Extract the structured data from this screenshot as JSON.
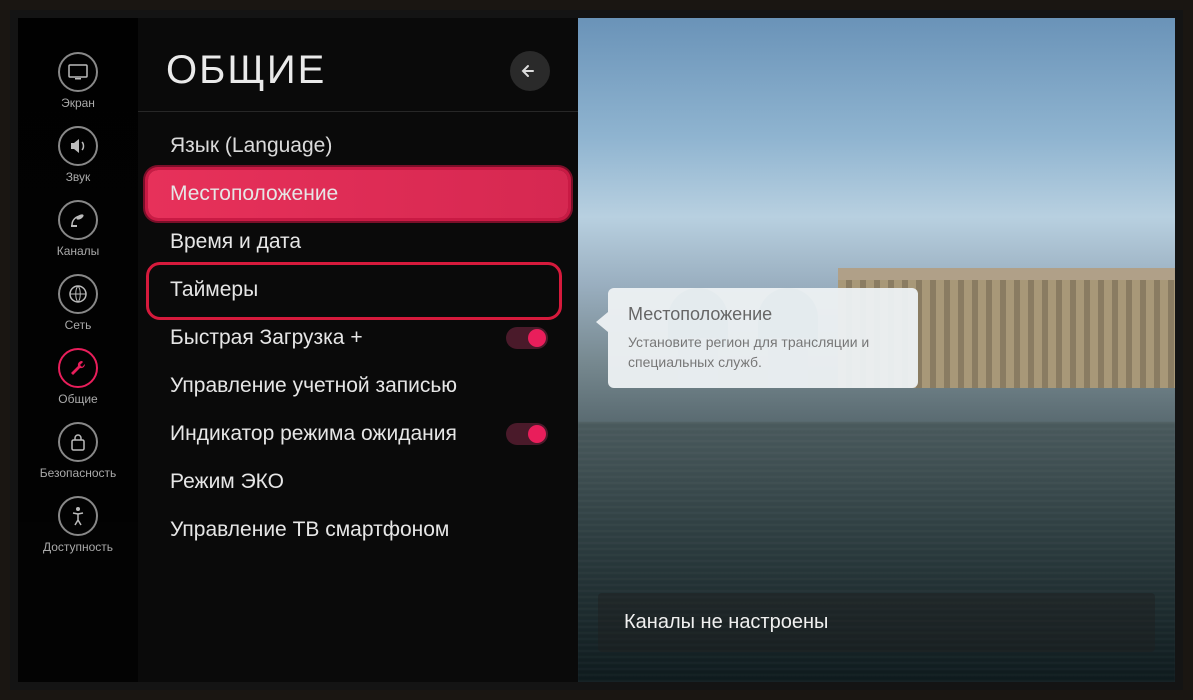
{
  "sidebar": {
    "items": [
      {
        "id": "screen",
        "label": "Экран",
        "icon": "tv-icon"
      },
      {
        "id": "sound",
        "label": "Звук",
        "icon": "speaker-icon"
      },
      {
        "id": "channels",
        "label": "Каналы",
        "icon": "satellite-icon"
      },
      {
        "id": "network",
        "label": "Сеть",
        "icon": "globe-icon"
      },
      {
        "id": "general",
        "label": "Общие",
        "icon": "wrench-icon",
        "active": true
      },
      {
        "id": "security",
        "label": "Безопасность",
        "icon": "lock-icon"
      },
      {
        "id": "accessibility",
        "label": "Доступность",
        "icon": "accessibility-icon"
      }
    ]
  },
  "panel": {
    "title": "ОБЩИЕ",
    "back_label": "Назад",
    "menu": [
      {
        "id": "language",
        "label": "Язык (Language)",
        "selected": false
      },
      {
        "id": "location",
        "label": "Местоположение",
        "selected": true
      },
      {
        "id": "datetime",
        "label": "Время и дата",
        "selected": false
      },
      {
        "id": "timers",
        "label": "Таймеры",
        "selected": false
      },
      {
        "id": "quickstart",
        "label": "Быстрая Загрузка +",
        "selected": false,
        "toggle": true
      },
      {
        "id": "account",
        "label": "Управление учетной записью",
        "selected": false
      },
      {
        "id": "standby-led",
        "label": "Индикатор режима ожидания",
        "selected": false,
        "toggle": true
      },
      {
        "id": "eco",
        "label": "Режим ЭКО",
        "selected": false
      },
      {
        "id": "phone-ctrl",
        "label": "Управление ТВ смартфоном",
        "selected": false
      }
    ]
  },
  "tooltip": {
    "title": "Местоположение",
    "body": "Установите регион для трансляции и специальных служб."
  },
  "status": {
    "message": "Каналы не настроены"
  },
  "colors": {
    "accent": "#e7315a",
    "highlight_border": "#d61a3c"
  }
}
